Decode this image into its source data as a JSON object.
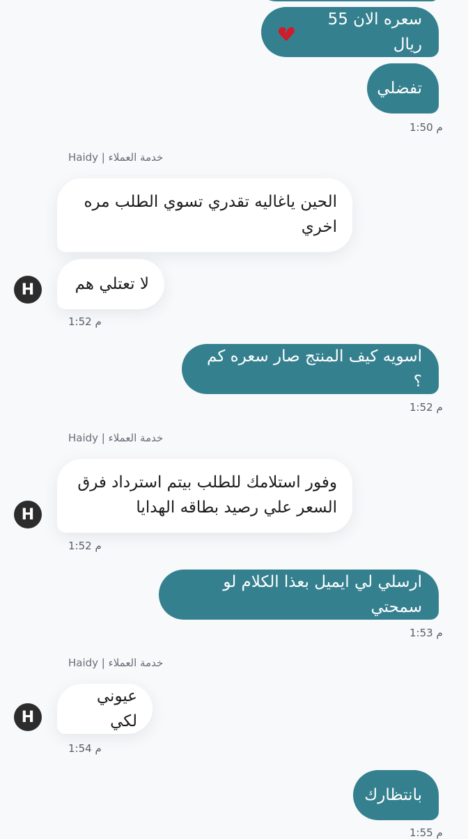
{
  "messages": [
    {
      "text": "سعره الان 55 ريال",
      "emoji": "💔"
    },
    {
      "text": "تفضلي"
    },
    {
      "time": "1:50 م"
    },
    {
      "sender": "Haidy | خدمة العملاء"
    },
    {
      "text": "الحين ياغاليه تقدري تسوي الطلب مره اخري"
    },
    {
      "text": "لا تعتلي هم"
    },
    {
      "time": "1:52 م"
    },
    {
      "text": "اسويه كيف المنتج صار سعره كم ؟"
    },
    {
      "time": "1:52 م"
    },
    {
      "sender": "Haidy | خدمة العملاء"
    },
    {
      "text": "وفور استلامك للطلب بيتم استرداد فرق السعر علي رصيد بطاقه الهدايا"
    },
    {
      "time": "1:52 م"
    },
    {
      "text": "ارسلي لي ايميل بعذا الكلام لو سمحتي"
    },
    {
      "time": "1:53 م"
    },
    {
      "sender": "Haidy | خدمة العملاء"
    },
    {
      "text": "عيوني لكي"
    },
    {
      "time": "1:54 م"
    },
    {
      "text": "بانتظارك"
    },
    {
      "time": "1:55 م"
    }
  ],
  "avatar_letter": "H",
  "colors": {
    "outgoing": "#35808f",
    "incoming": "#ffffff",
    "background": "#f8f9fb"
  }
}
